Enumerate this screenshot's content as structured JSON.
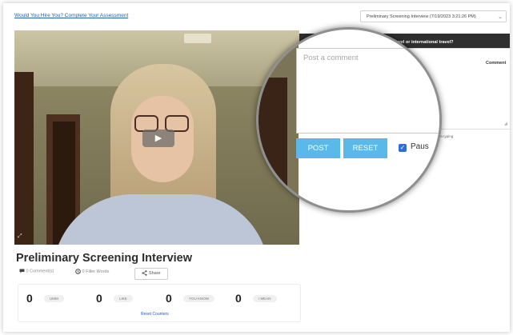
{
  "header": {
    "assessment_link": "Would You Hire You? Complete Your Assessment",
    "session_select_value": "Preliminary Screening Interview (7/19/2023 3:21:26 PM)",
    "session_select_chevron": "⌄"
  },
  "video": {
    "play_icon": "▶",
    "expand_icon": "⤢"
  },
  "interview": {
    "title": "Preliminary Screening Interview",
    "comments_count": "0 Comment(s)",
    "filler_words": "0 Filler Words",
    "share_label": "Share"
  },
  "counters": {
    "items": [
      {
        "value": "0",
        "label": "UMM"
      },
      {
        "value": "0",
        "label": "LIKE"
      },
      {
        "value": "0",
        "label": "YOU KNOW"
      },
      {
        "value": "0",
        "label": "I MEAN"
      }
    ],
    "reset_label": "Reset Counters"
  },
  "question": {
    "header_text": "rs travel or international travel?"
  },
  "comments": {
    "column_label": "Comment",
    "placeholder": "Post a comment",
    "post_label": "POST",
    "reset_label": "RESET",
    "pause_label": "Paus",
    "begin_typing_hint": "begin typing"
  },
  "colors": {
    "accent_button": "#5ab9e8",
    "link": "#2a5bb8",
    "header_dark": "#2f2f2f",
    "checkbox": "#2f6fd1"
  },
  "icons": {
    "comment": "comment-icon",
    "filter": "filter-words-icon",
    "share": "share-icon",
    "play": "play-icon"
  }
}
